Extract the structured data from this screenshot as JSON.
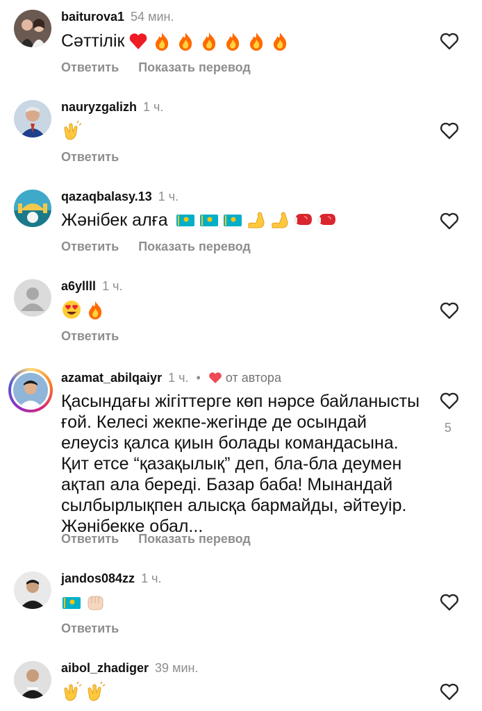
{
  "labels": {
    "reply": "Ответить",
    "translate": "Показать перевод",
    "from_author": "от автора"
  },
  "comments": [
    {
      "username": "baiturova1",
      "time": "54 мин.",
      "text": "Сәттілік",
      "emojis": [
        "red-heart",
        "fire",
        "fire",
        "fire",
        "fire",
        "fire",
        "fire"
      ],
      "translate": true
    },
    {
      "username": "nauryzgalizh",
      "time": "1 ч.",
      "text": "",
      "emojis": [
        "clapping-hands"
      ],
      "translate": false
    },
    {
      "username": "qazaqbalasy.13",
      "time": "1 ч.",
      "text": "Жәнібек алға",
      "emojis": [
        "kazakhstan-flag",
        "kazakhstan-flag",
        "kazakhstan-flag",
        "flexed-biceps",
        "flexed-biceps",
        "boxing-glove",
        "boxing-glove"
      ],
      "translate": true
    },
    {
      "username": "а6уllll",
      "time": "1 ч.",
      "text": "",
      "emojis": [
        "heart-eyes",
        "fire"
      ],
      "translate": false
    },
    {
      "username": "azamat_abilqaiyr",
      "time": "1 ч.",
      "liked_by_author": true,
      "text": "Қасындағы жігіттерге көп нәрсе байланысты ғой. Келесі жекпе-жегінде де осындай елеусіз қалса қиын болады командасына. Қит етсе “қазақылық” деп, бла-бла деумен ақтап ала береді. Базар баба! Мынандай сылбырлықпен алысқа бармайды, әйтеуір. Жәнібекке обал...",
      "emojis": [],
      "translate": true,
      "likes": "5"
    },
    {
      "username": "jandos084zz",
      "time": "1 ч.",
      "text": "",
      "emojis": [
        "kazakhstan-flag",
        "oncoming-fist"
      ],
      "translate": false
    },
    {
      "username": "aibol_zhadiger",
      "time": "39 мин.",
      "text": "",
      "emojis": [
        "clapping-hands",
        "clapping-hands"
      ],
      "translate": false
    }
  ],
  "colors": {
    "accent_red": "#ed4956",
    "muted": "#8e8e8e"
  }
}
